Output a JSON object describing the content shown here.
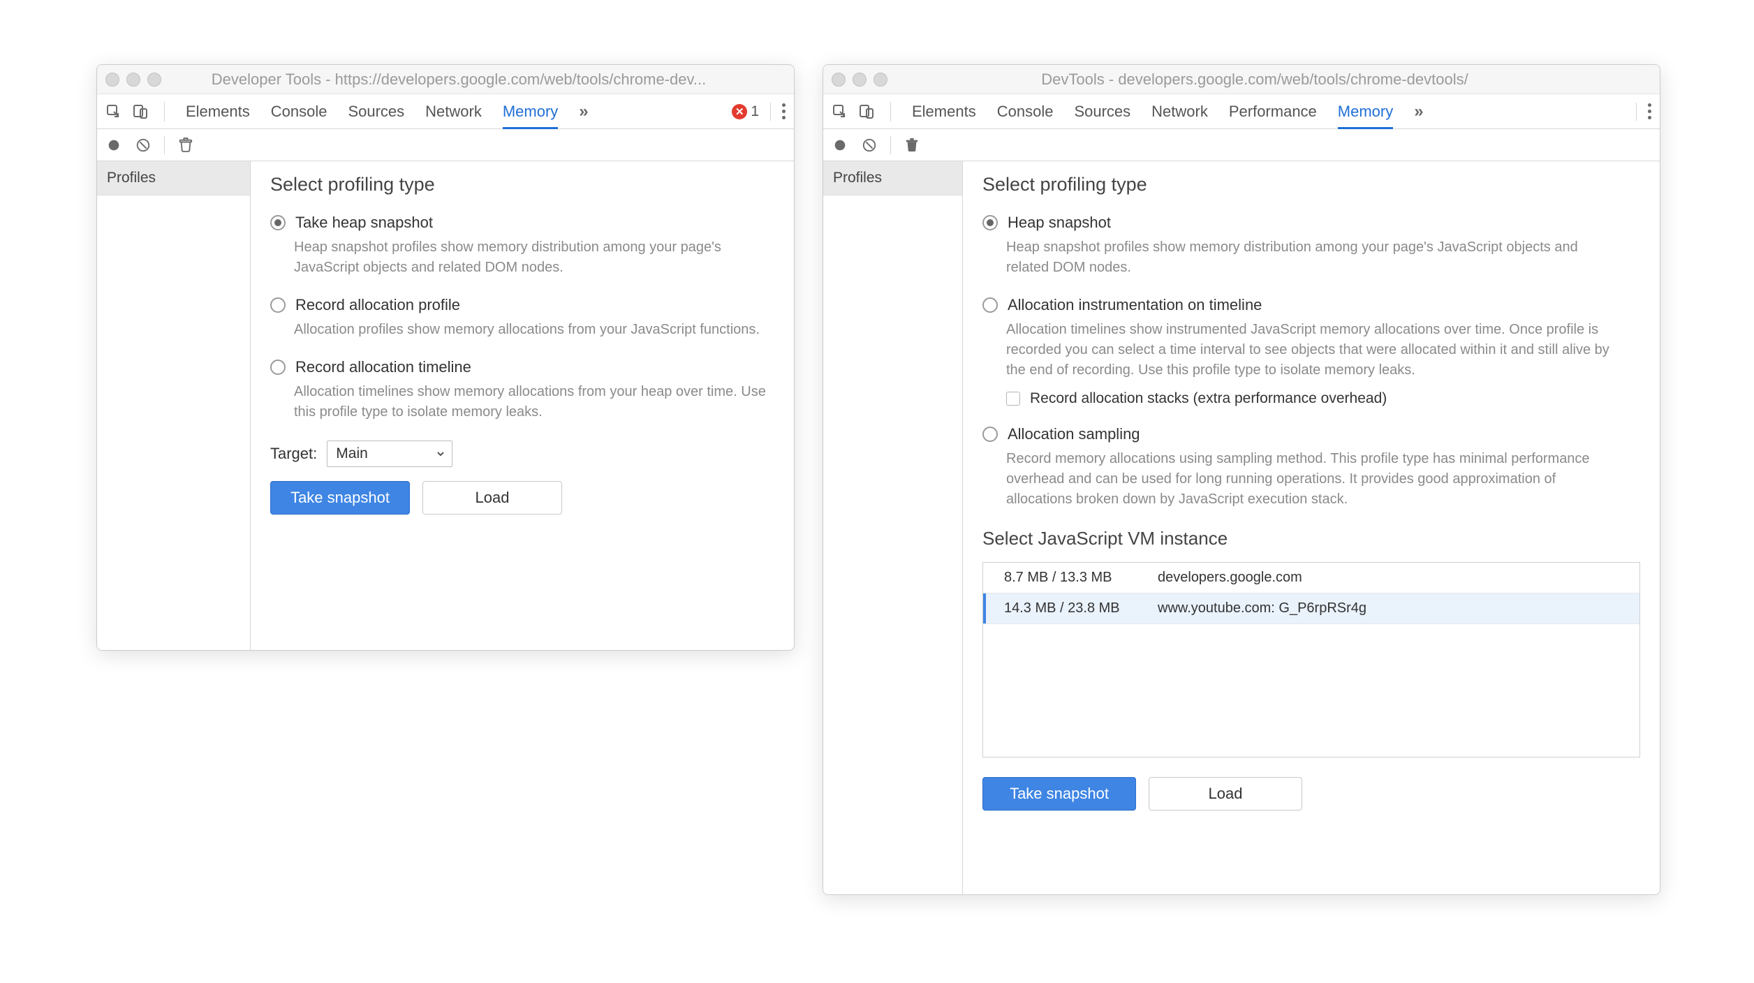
{
  "left": {
    "title": "Developer Tools - https://developers.google.com/web/tools/chrome-dev...",
    "tabs": [
      "Elements",
      "Console",
      "Sources",
      "Network",
      "Memory"
    ],
    "active_tab": "Memory",
    "overflow_glyph": "»",
    "error_count": "1",
    "sidebar": {
      "profiles": "Profiles"
    },
    "main": {
      "heading": "Select profiling type",
      "opt1": {
        "label": "Take heap snapshot",
        "desc": "Heap snapshot profiles show memory distribution among your page's JavaScript objects and related DOM nodes."
      },
      "opt2": {
        "label": "Record allocation profile",
        "desc": "Allocation profiles show memory allocations from your JavaScript functions."
      },
      "opt3": {
        "label": "Record allocation timeline",
        "desc": "Allocation timelines show memory allocations from your heap over time. Use this profile type to isolate memory leaks."
      },
      "target_label": "Target:",
      "target_value": "Main",
      "take_btn": "Take snapshot",
      "load_btn": "Load"
    }
  },
  "right": {
    "title": "DevTools - developers.google.com/web/tools/chrome-devtools/",
    "tabs": [
      "Elements",
      "Console",
      "Sources",
      "Network",
      "Performance",
      "Memory"
    ],
    "active_tab": "Memory",
    "overflow_glyph": "»",
    "sidebar": {
      "profiles": "Profiles"
    },
    "main": {
      "heading": "Select profiling type",
      "opt1": {
        "label": "Heap snapshot",
        "desc": "Heap snapshot profiles show memory distribution among your page's JavaScript objects and related DOM nodes."
      },
      "opt2": {
        "label": "Allocation instrumentation on timeline",
        "desc": "Allocation timelines show instrumented JavaScript memory allocations over time. Once profile is recorded you can select a time interval to see objects that were allocated within it and still alive by the end of recording. Use this profile type to isolate memory leaks."
      },
      "opt2_cb": "Record allocation stacks (extra performance overhead)",
      "opt3": {
        "label": "Allocation sampling",
        "desc": "Record memory allocations using sampling method. This profile type has minimal performance overhead and can be used for long running operations. It provides good approximation of allocations broken down by JavaScript execution stack."
      },
      "vm_heading": "Select JavaScript VM instance",
      "vm": [
        {
          "size": "8.7 MB / 13.3 MB",
          "name": "developers.google.com"
        },
        {
          "size": "14.3 MB / 23.8 MB",
          "name": "www.youtube.com: G_P6rpRSr4g"
        }
      ],
      "take_btn": "Take snapshot",
      "load_btn": "Load"
    }
  }
}
